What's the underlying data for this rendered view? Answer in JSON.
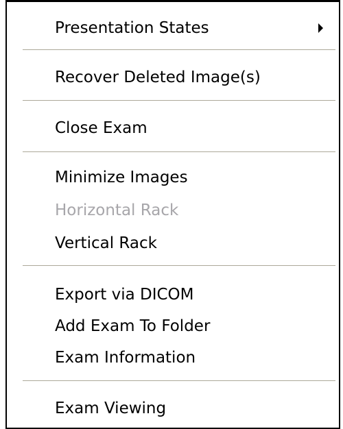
{
  "menu": {
    "items": [
      {
        "label": "Presentation States",
        "enabled": true,
        "submenu": true
      },
      {
        "label": "Recover Deleted Image(s)",
        "enabled": true
      },
      {
        "label": "Close Exam",
        "enabled": true
      },
      {
        "label": "Minimize Images",
        "enabled": true
      },
      {
        "label": "Horizontal Rack",
        "enabled": false
      },
      {
        "label": "Vertical Rack",
        "enabled": true
      },
      {
        "label": "Export via DICOM",
        "enabled": true
      },
      {
        "label": "Add Exam To Folder",
        "enabled": true
      },
      {
        "label": "Exam Information",
        "enabled": true
      },
      {
        "label": "Exam Viewing",
        "enabled": true
      }
    ],
    "submenu_icon": "submenu-arrow-icon",
    "colors": {
      "text": "#000000",
      "disabled_text": "#a7a6aa",
      "separator": "#aca899",
      "background": "#ffffff",
      "border": "#000000"
    }
  }
}
